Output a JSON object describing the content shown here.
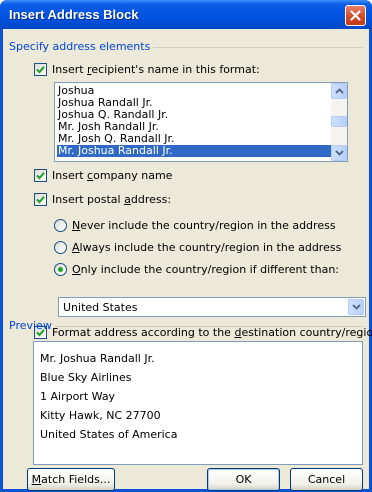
{
  "window": {
    "title": "Insert Address Block"
  },
  "sections": {
    "address_elements": "Specify address elements",
    "preview": "Preview"
  },
  "recipient_name": {
    "checked": true,
    "label_pre": "Insert ",
    "label_key": "r",
    "label_post": "ecipient's name in this format:",
    "formats": [
      "Joshua",
      "Joshua Randall Jr.",
      "Joshua Q. Randall Jr.",
      "Mr. Josh Randall Jr.",
      "Mr. Josh Q. Randall Jr.",
      "Mr. Joshua Randall Jr."
    ],
    "selected_format": "Mr. Joshua Randall Jr."
  },
  "company_name": {
    "checked": true,
    "label_pre": "Insert ",
    "label_key": "c",
    "label_post": "ompany name"
  },
  "postal_address": {
    "checked": true,
    "label_pre": "Insert postal ",
    "label_key": "a",
    "label_post": "ddress:",
    "options": [
      {
        "key": "N",
        "rest": "ever include the country/region in the address",
        "selected": false
      },
      {
        "key": "A",
        "rest": "lways include the country/region in the address",
        "selected": false
      },
      {
        "key": "O",
        "rest": "nly include the country/region if different than:",
        "selected": true
      }
    ],
    "country": "United States"
  },
  "format_address": {
    "checked": true,
    "label_pre": "Format address according to the ",
    "label_key": "d",
    "label_post": "estination country/region"
  },
  "preview_lines": [
    "Mr. Joshua Randall Jr.",
    "Blue Sky Airlines",
    "1 Airport Way",
    "Kitty Hawk, NC 27700",
    "United States of America"
  ],
  "buttons": {
    "match_key": "M",
    "match_rest": "atch Fields...",
    "ok": "OK",
    "cancel": "Cancel"
  }
}
